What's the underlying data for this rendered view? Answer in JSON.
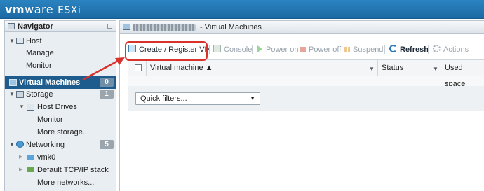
{
  "header": {
    "brand_vm": "vm",
    "brand_ware": "ware",
    "product": "ESXi"
  },
  "navigator": {
    "title": "Navigator",
    "items": [
      {
        "label": "Host"
      },
      {
        "label": "Manage"
      },
      {
        "label": "Monitor"
      },
      {
        "label": "Virtual Machines",
        "count": "0"
      },
      {
        "label": "Storage",
        "count": "1"
      },
      {
        "label": "Host Drives"
      },
      {
        "label": "Monitor"
      },
      {
        "label": "More storage..."
      },
      {
        "label": "Networking",
        "count": "5"
      },
      {
        "label": "vmk0"
      },
      {
        "label": "Default TCP/IP stack"
      },
      {
        "label": "More networks..."
      }
    ]
  },
  "main": {
    "breadcrumb_suffix": " - Virtual Machines",
    "toolbar": {
      "create": "Create / Register VM",
      "console": "Console",
      "power_on": "Power on",
      "power_off": "Power off",
      "suspend": "Suspend",
      "refresh": "Refresh",
      "actions": "Actions"
    },
    "table": {
      "columns": [
        "Virtual machine ▲",
        "Status",
        "Used space"
      ]
    },
    "quick_filters": "Quick filters..."
  },
  "colors": {
    "header": "#1c6aa4",
    "selected": "#1d5c8c",
    "annotation": "#d9322c"
  }
}
